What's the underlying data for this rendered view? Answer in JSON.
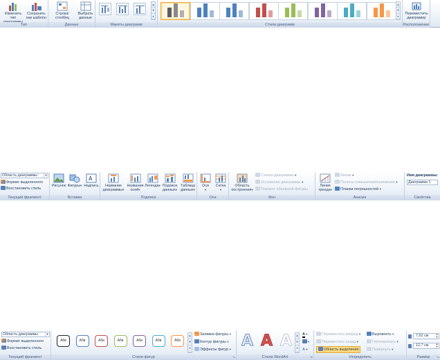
{
  "ribbon_design": {
    "group_type": {
      "label": "Тип",
      "change_type": "Изменить тип диаграммы",
      "save_template": "Сохранить как шаблон"
    },
    "group_data": {
      "label": "Данные",
      "switch_row_col": "Строка/столбец",
      "select_data": "Выбрать данные"
    },
    "group_layouts": {
      "label": "Макеты диаграмм"
    },
    "group_styles": {
      "label": "Стили диаграмм"
    },
    "group_location": {
      "label": "Расположение",
      "move_chart": "Переместить диаграмму"
    },
    "style_colors": [
      "#6e6e6e",
      "#4f81bd",
      "#4f81bd",
      "#c0504d",
      "#9bbb59",
      "#8064a2",
      "#4bacc6",
      "#f79646"
    ]
  },
  "ribbon_layout": {
    "current_fragment": {
      "label": "Текущий фрагмент",
      "combo_value": "Область диаграммы",
      "format_selection": "Формат выделенного",
      "reset_style": "Восстановить стиль"
    },
    "group_insert": {
      "label": "Вставка",
      "picture": "Рисунок",
      "shapes": "Фигуры",
      "textbox": "Надпись"
    },
    "group_labels": {
      "label": "Подписи",
      "chart_title": "Название диаграммы",
      "axis_titles": "Названия осей",
      "legend": "Легенда",
      "data_labels": "Подписи данных",
      "data_table": "Таблица данных"
    },
    "group_axes": {
      "label": "Оси",
      "axes": "Оси",
      "gridlines": "Сетка"
    },
    "group_background": {
      "label": "Фон",
      "plot_area": "Область построения",
      "chart_wall": "Стенка диаграммы",
      "chart_floor": "Основание диаграммы",
      "rotation_3d": "Поворот объемной фигуры"
    },
    "group_analysis": {
      "label": "Анализ",
      "trendline": "Линия тренда",
      "lines": "Линии",
      "updown_bars": "Полосы повышения/понижения",
      "error_bars": "Планки погрешностей"
    },
    "group_properties": {
      "label": "Свойства",
      "chart_name_label": "Имя диаграммы:",
      "chart_name_value": "Диаграмма 1"
    }
  },
  "ribbon_format": {
    "current_fragment": {
      "label": "Текущий фрагмент",
      "combo_value": "Область диаграммы",
      "format_selection": "Формат выделенного",
      "reset_style": "Восстановить стиль"
    },
    "shape_styles": {
      "label": "Стили фигур",
      "sample_text": "Абв",
      "fill": "Заливка фигуры",
      "outline": "Контур фигуры",
      "effects": "Эффекты фигур",
      "border_colors": [
        "#222222",
        "#4f81bd",
        "#c0504d",
        "#9bbb59",
        "#8064a2",
        "#4bacc6",
        "#f79646"
      ]
    },
    "wordart_styles": {
      "label": "Стили WordArt",
      "letter": "A"
    },
    "arrange": {
      "label": "Упорядочить",
      "bring_forward": "Переместить вперед",
      "send_backward": "Переместить назад",
      "selection_pane": "Область выделения",
      "align": "Выровнять",
      "group": "Группировать",
      "rotate": "Повернуть"
    },
    "size": {
      "label": "Размер",
      "height": "7,62 см",
      "width": "12,7 см"
    }
  }
}
